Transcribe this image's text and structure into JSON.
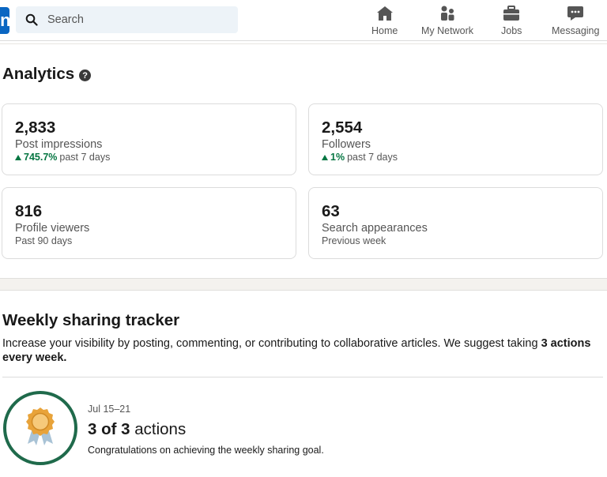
{
  "header": {
    "search_placeholder": "Search",
    "nav": [
      {
        "label": "Home",
        "icon": "home-icon"
      },
      {
        "label": "My Network",
        "icon": "network-icon"
      },
      {
        "label": "Jobs",
        "icon": "briefcase-icon"
      },
      {
        "label": "Messaging",
        "icon": "messaging-icon"
      }
    ],
    "logo_letter": "in"
  },
  "analytics": {
    "title": "Analytics",
    "help": "?",
    "cards": [
      {
        "value": "2,833",
        "label": "Post impressions",
        "change": "745.7%",
        "period": "past 7 days"
      },
      {
        "value": "2,554",
        "label": "Followers",
        "change": "1%",
        "period": "past 7 days"
      },
      {
        "value": "816",
        "label": "Profile viewers",
        "period": "Past 90 days"
      },
      {
        "value": "63",
        "label": "Search appearances",
        "period": "Previous week"
      }
    ]
  },
  "tracker": {
    "title": "Weekly sharing tracker",
    "desc_prefix": "Increase your visibility by posting, commenting, or contributing to collaborative articles. We suggest taking ",
    "desc_bold": "3 actions every week.",
    "week": "Jul 15–21",
    "actions_bold": "3 of 3",
    "actions_suffix": " actions",
    "congrats": "Congratulations on achieving the weekly sharing goal."
  },
  "colors": {
    "brand": "#0a66c2",
    "positive": "#057642",
    "ring": "#1f6a4b",
    "medal": "#e8a33a"
  }
}
